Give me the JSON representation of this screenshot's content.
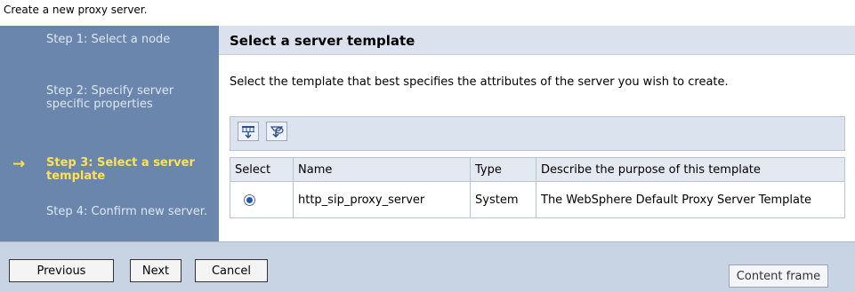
{
  "page": {
    "caption": "Create a new proxy server."
  },
  "sidebar": {
    "steps": [
      {
        "label": "Step 1: Select a node",
        "current": false
      },
      {
        "label": "Step 2: Specify server specific properties",
        "current": false
      },
      {
        "label": "Step 3: Select a server template",
        "current": true
      },
      {
        "label": "Step 4: Confirm new server.",
        "current": false
      }
    ],
    "current_marker": "→"
  },
  "main": {
    "title": "Select a server template",
    "instruction": "Select the template that best specifies the attributes of the server you wish to create.",
    "toolbar": {
      "icons": [
        "select-all-icon",
        "deselect-all-icon"
      ]
    },
    "table": {
      "headers": [
        "Select",
        "Name",
        "Type",
        "Describe the purpose of this template"
      ],
      "rows": [
        {
          "selected": true,
          "name": "http_sip_proxy_server",
          "type": "System",
          "description": "The WebSphere Default Proxy Server Template"
        }
      ]
    }
  },
  "footer": {
    "previous_label": "Previous",
    "next_label": "Next",
    "cancel_label": "Cancel",
    "content_frame_label": "Content frame"
  },
  "colors": {
    "sidebar_bg": "#6a86ad",
    "current_step": "#ffe34d",
    "header_bg": "#dbe2ee",
    "footer_bg": "#c8d4e4"
  }
}
